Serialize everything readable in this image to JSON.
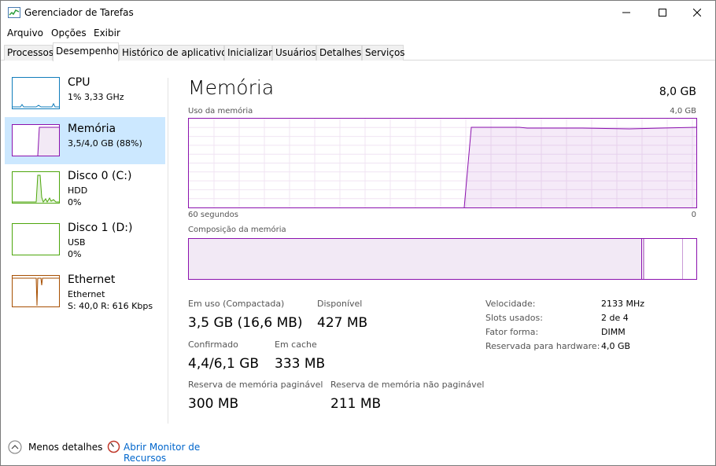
{
  "window": {
    "title": "Gerenciador de Tarefas"
  },
  "menu": [
    "Arquivo",
    "Opções",
    "Exibir"
  ],
  "tabs": [
    "Processos",
    "Desempenho",
    "Histórico de aplicativos",
    "Inicializar",
    "Usuários",
    "Detalhes",
    "Serviços"
  ],
  "active_tab": "Desempenho",
  "sidebar": {
    "items": [
      {
        "name": "CPU",
        "line1": "1%  3,33 GHz",
        "line2": "",
        "color": "#117dbb"
      },
      {
        "name": "Memória",
        "line1": "3,5/4,0 GB (88%)",
        "line2": "",
        "color": "#8b12ae",
        "selected": true
      },
      {
        "name": "Disco 0 (C:)",
        "line1": "HDD",
        "line2": "0%",
        "color": "#4da60c"
      },
      {
        "name": "Disco 1 (D:)",
        "line1": "USB",
        "line2": "0%",
        "color": "#4da60c"
      },
      {
        "name": "Ethernet",
        "line1": "Ethernet",
        "line2": "S: 40,0  R: 616 Kbps",
        "color": "#a74f01"
      }
    ]
  },
  "main": {
    "title": "Memória",
    "total": "8,0 GB",
    "usage_label": "Uso da memória",
    "usage_max": "4,0 GB",
    "time_left": "60 segundos",
    "time_right": "0",
    "composition_label": "Composição da memória",
    "stats": {
      "in_use_label": "Em uso (Compactada)",
      "in_use_value": "3,5 GB (16,6 MB)",
      "available_label": "Disponível",
      "available_value": "427 MB",
      "committed_label": "Confirmado",
      "committed_value": "4,4/6,1 GB",
      "cached_label": "Em cache",
      "cached_value": "333 MB",
      "paged_label": "Reserva de memória paginável",
      "paged_value": "300 MB",
      "nonpaged_label": "Reserva de memória não paginável",
      "nonpaged_value": "211 MB"
    },
    "specs": [
      {
        "label": "Velocidade:",
        "value": "2133 MHz"
      },
      {
        "label": "Slots usados:",
        "value": "2 de 4"
      },
      {
        "label": "Fator forma:",
        "value": "DIMM"
      },
      {
        "label": "Reservada para hardware:",
        "value": "4,0 GB"
      }
    ],
    "accent_color": "#8b12ae"
  },
  "footer": {
    "less_details": "Menos detalhes",
    "open_monitor": "Abrir Monitor de Recursos"
  }
}
